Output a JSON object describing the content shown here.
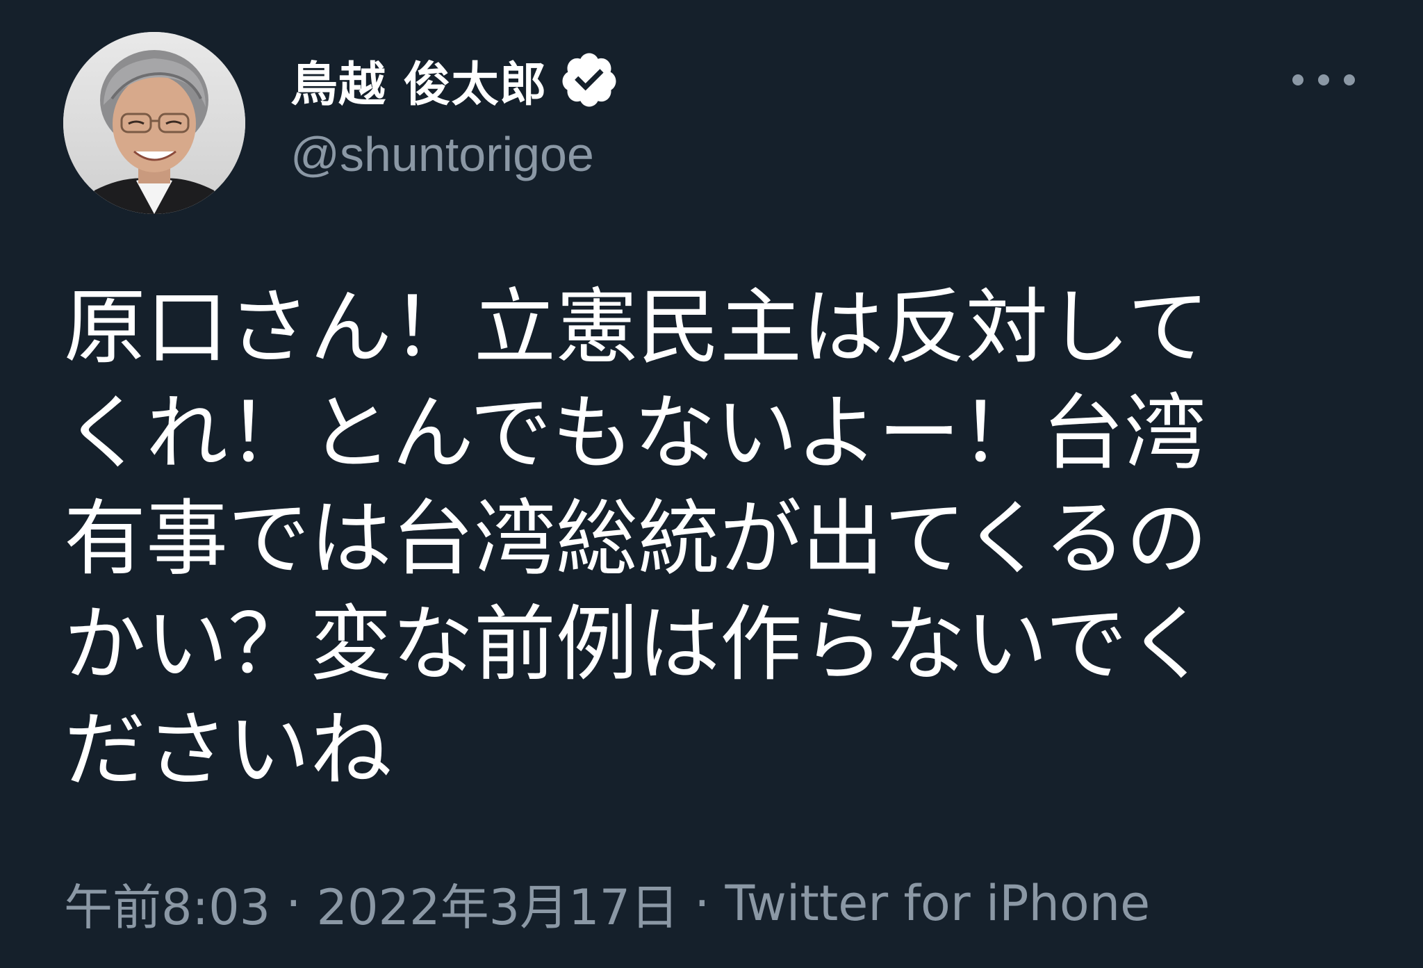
{
  "tweet": {
    "author": {
      "display_name": "鳥越 俊太郎",
      "handle": "@shuntorigoe",
      "verified": true,
      "avatar_icon": "profile-photo"
    },
    "more_icon": "more-horizontal-icon",
    "text": "原口さん！立憲民主は反対して\nくれ！とんでもないよー！台湾\n有事では台湾総統が出てくるの\nかい？変な前例は作らないでく\nださいね",
    "time": "午前8:03",
    "date": "2022年3月17日",
    "separator": "·",
    "source": "Twitter for iPhone"
  },
  "colors": {
    "background": "#15202B",
    "text_primary": "#FFFFFF",
    "text_secondary": "#8B98A5"
  }
}
